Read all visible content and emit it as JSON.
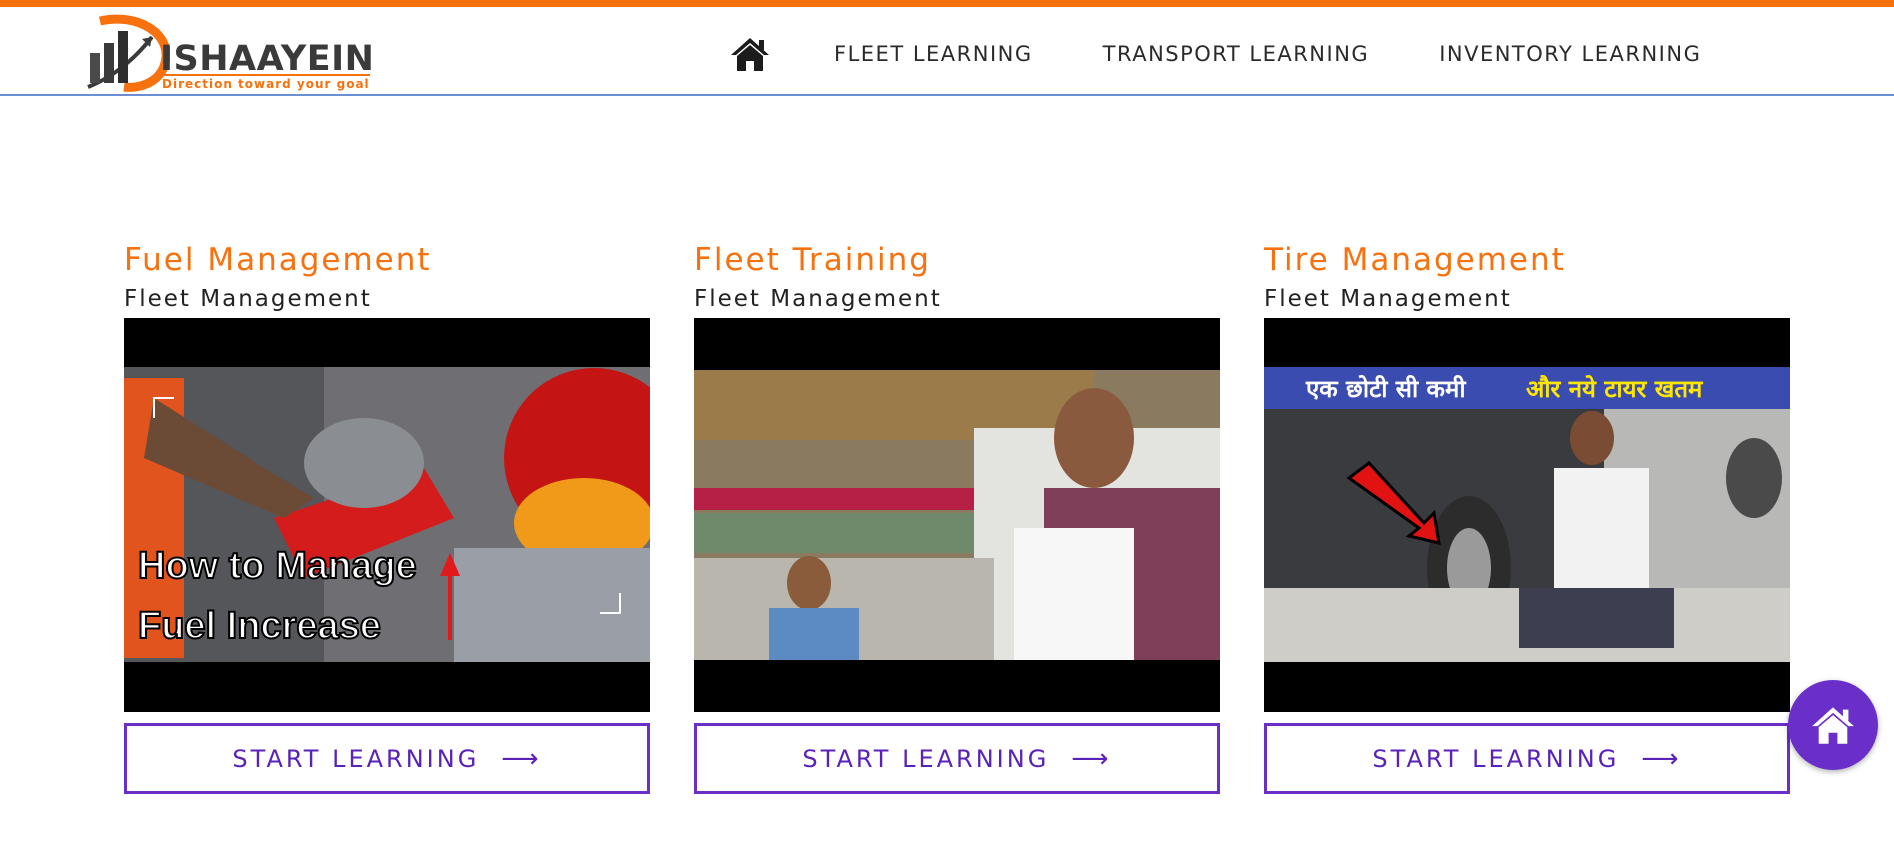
{
  "header": {
    "logo_text": "ISHAAYEIN",
    "logo_tagline": "Direction toward your goal",
    "home_icon": "home-icon",
    "nav": [
      {
        "label": "FLEET LEARNING"
      },
      {
        "label": "TRANSPORT LEARNING"
      },
      {
        "label": "INVENTORY LEARNING"
      }
    ]
  },
  "cards": [
    {
      "title": "Fuel Management",
      "subtitle": "Fleet Management",
      "thumbnail_text": [
        "How to Manage",
        "Fuel Increase"
      ],
      "button_label": "START LEARNING"
    },
    {
      "title": "Fleet Training",
      "subtitle": "Fleet Management",
      "button_label": "START LEARNING"
    },
    {
      "title": "Tire Management",
      "subtitle": "Fleet Management",
      "thumbnail_text": [
        "एक छोटी सी कमी",
        "और नये टायर खतम"
      ],
      "button_label": "START LEARNING"
    }
  ],
  "floating_button_icon": "home-icon",
  "colors": {
    "accent_orange": "#f7720f",
    "accent_purple": "#6b2fc7",
    "header_border": "#6a8fd3"
  }
}
